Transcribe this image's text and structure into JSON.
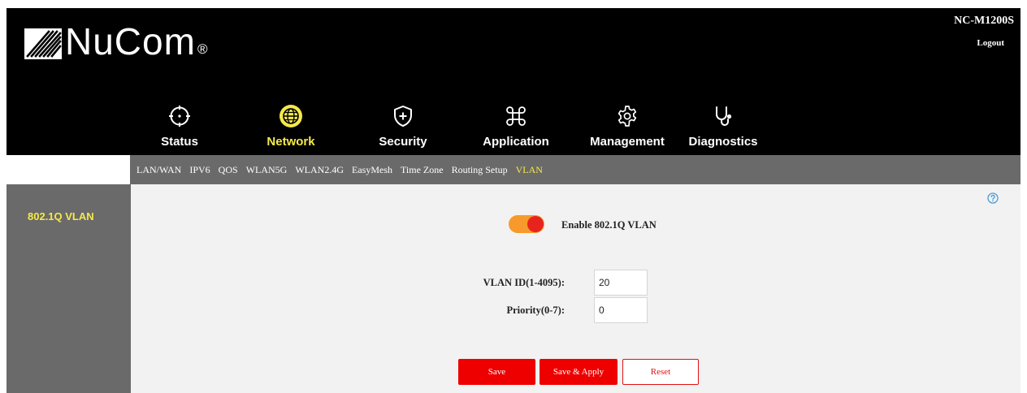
{
  "header": {
    "brand": "NuCom",
    "registered_mark": "®",
    "model": "NC-M1200S",
    "logout_label": "Logout"
  },
  "nav": {
    "items": [
      {
        "label": "Status",
        "icon": "crosshair-icon"
      },
      {
        "label": "Network",
        "icon": "globe-icon",
        "active": true
      },
      {
        "label": "Security",
        "icon": "shield-plus-icon"
      },
      {
        "label": "Application",
        "icon": "command-icon"
      },
      {
        "label": "Management",
        "icon": "gear-icon"
      },
      {
        "label": "Diagnostics",
        "icon": "stethoscope-icon"
      }
    ]
  },
  "subnav": {
    "items": [
      {
        "label": "LAN/WAN"
      },
      {
        "label": "IPV6"
      },
      {
        "label": "QOS"
      },
      {
        "label": "WLAN5G"
      },
      {
        "label": "WLAN2.4G"
      },
      {
        "label": "EasyMesh"
      },
      {
        "label": "Time Zone"
      },
      {
        "label": "Routing Setup"
      },
      {
        "label": "VLAN",
        "active": true
      }
    ]
  },
  "sidebar": {
    "items": [
      {
        "label": "802.1Q VLAN",
        "active": true
      }
    ]
  },
  "form": {
    "enable_label": "Enable 802.1Q VLAN",
    "enabled": true,
    "vlan_id_label": "VLAN ID(1-4095):",
    "vlan_id_value": "20",
    "priority_label": "Priority(0-7):",
    "priority_value": "0"
  },
  "buttons": {
    "save": "Save",
    "save_apply": "Save & Apply",
    "reset": "Reset"
  },
  "colors": {
    "accent_yellow": "#f5e94a",
    "primary_red": "#ee0000",
    "toggle_orange": "#f79a2b",
    "header_black": "#000000",
    "panel_gray": "#6a6a6a",
    "content_bg": "#f2f2f2"
  }
}
